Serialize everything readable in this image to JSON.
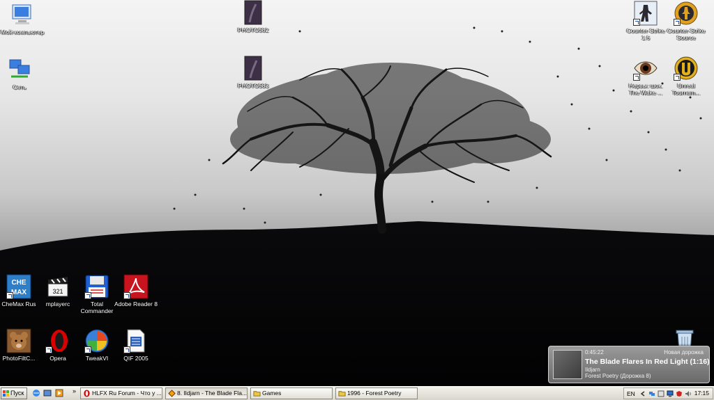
{
  "desktop": {
    "icons": [
      {
        "id": "my-computer",
        "label": "Мой компьютер",
        "icon": "computer-icon"
      },
      {
        "id": "network",
        "label": "Сеть",
        "icon": "network-icon"
      },
      {
        "id": "photo-1",
        "label": "PHOTO582",
        "icon": "photo-icon"
      },
      {
        "id": "photo-2",
        "label": "PHOTO583",
        "icon": "photo-icon"
      },
      {
        "id": "counter-strike",
        "label": "Counter-Strike 1.6",
        "icon": "counter-strike-icon"
      },
      {
        "id": "counter-strike-source",
        "label": "Counter-Strike Source",
        "icon": "counter-strike-source-icon"
      },
      {
        "id": "nerves",
        "label": "Нервы: шок. The Wake ...",
        "icon": "eye-icon"
      },
      {
        "id": "unreal",
        "label": "Unreal Tournam...",
        "icon": "unreal-icon"
      },
      {
        "id": "chemax",
        "label": "CheMax Rus",
        "icon": "chemax-icon"
      },
      {
        "id": "mplayerc",
        "label": "mplayerc",
        "icon": "clapperboard-icon"
      },
      {
        "id": "total-commander",
        "label": "Total Commander",
        "icon": "floppy-icon"
      },
      {
        "id": "adobe-reader",
        "label": "Adobe Reader 8",
        "icon": "adobe-reader-icon"
      },
      {
        "id": "photofilter",
        "label": "PhotoFiltC...",
        "icon": "bear-icon"
      },
      {
        "id": "opera",
        "label": "Opera",
        "icon": "opera-icon"
      },
      {
        "id": "tweakvi",
        "label": "TweakVI",
        "icon": "tweakvi-icon"
      },
      {
        "id": "qif",
        "label": "QIF 2005",
        "icon": "document-icon"
      },
      {
        "id": "recycle-bin",
        "label": "",
        "icon": "recycle-bin-icon"
      }
    ]
  },
  "notification": {
    "time": "0:45:22",
    "header": "Новая дорожка",
    "title": "The Blade Flares In Red Light (1:16)",
    "artist": "Ildjarn",
    "album": "Forest Poetry (Дорожка 8)"
  },
  "taskbar": {
    "start_label": "Пуск",
    "more_label": "»",
    "tasks": [
      {
        "label": "HLFX Ru Forum - Что у ...",
        "icon": "opera-icon"
      },
      {
        "label": "8. Ildjarn - The Blade Fla...",
        "icon": "winamp-icon"
      },
      {
        "label": "Games",
        "icon": "folder-icon"
      },
      {
        "label": "1996 - Forest Poetry",
        "icon": "folder-icon"
      }
    ],
    "tray": {
      "language": "EN",
      "clock": "17:15"
    }
  },
  "colors": {
    "taskbar_bg": "#e6e4da",
    "folder": "#e8c848",
    "label_text": "#ffffff"
  }
}
